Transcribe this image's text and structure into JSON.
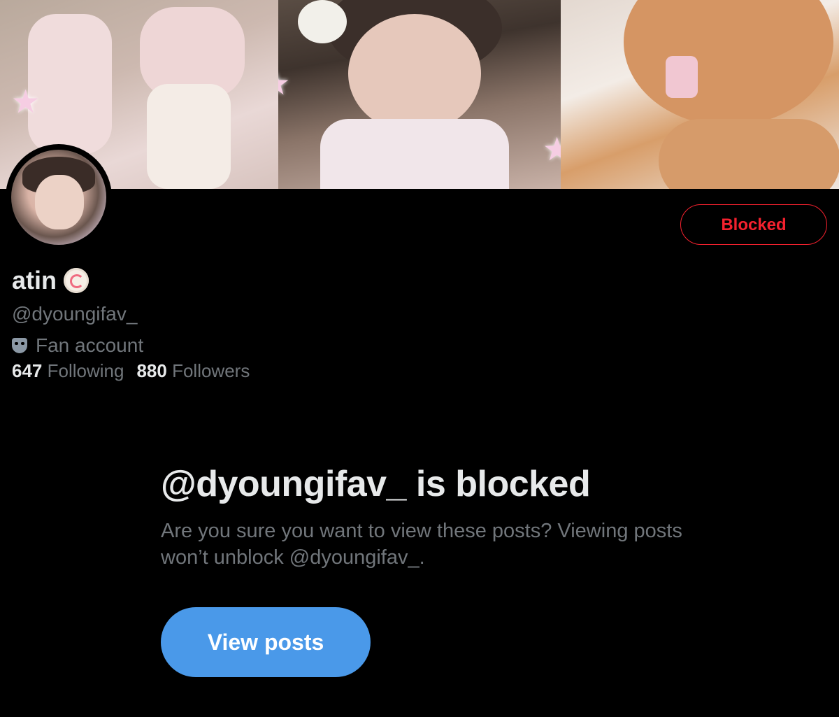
{
  "profile": {
    "display_name": "atin",
    "handle": "@dyoungifav_",
    "category": "Fan account",
    "following_count": "647",
    "following_label": "Following",
    "followers_count": "880",
    "followers_label": "Followers",
    "action_button_label": "Blocked"
  },
  "blocked_notice": {
    "title": "@dyoungifav_ is blocked",
    "message": "Are you sure you want to view these posts? Viewing posts won’t unblock @dyoungifav_.",
    "button_label": "View posts"
  },
  "colors": {
    "blocked_red": "#f4212e",
    "primary_blue": "#4a99e9",
    "secondary_text": "#71767b"
  },
  "icons": {
    "verified_badge": "narutomaki-badge-icon",
    "category_icon": "mask-icon"
  }
}
